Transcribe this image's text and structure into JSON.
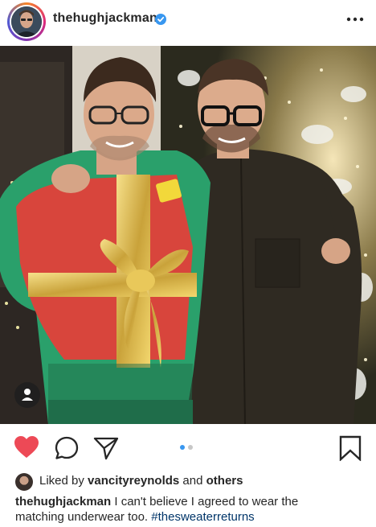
{
  "post": {
    "username": "thehughjackman",
    "verified": true,
    "more_icon": "more-horizontal-icon"
  },
  "photo": {
    "description_icon": "photo",
    "tag_icon": "user-tag-icon"
  },
  "actions": {
    "like_icon": "heart-filled-icon",
    "like_color": "#ed4956",
    "comment_icon": "comment-icon",
    "share_icon": "send-icon",
    "save_icon": "bookmark-icon",
    "carousel": {
      "total": 2,
      "current": 1,
      "active_color": "#3897f0"
    }
  },
  "likes": {
    "prefix": "Liked by ",
    "user": "vancityreynolds",
    "middle": " and ",
    "others": "others"
  },
  "caption": {
    "username": "thehughjackman",
    "text_line1": " I can't believe I agreed to wear the",
    "text_line2": "matching underwear too. ",
    "hashtag": "#thesweaterreturns"
  }
}
